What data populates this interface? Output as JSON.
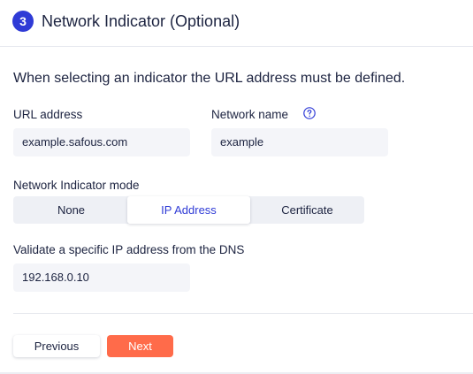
{
  "header": {
    "step_number": "3",
    "title": "Network Indicator (Optional)"
  },
  "intro_text": "When selecting an indicator the URL address must be defined.",
  "url_address": {
    "label": "URL address",
    "value": "example.safous.com"
  },
  "network_name": {
    "label": "Network name",
    "value": "example",
    "help_icon": "question-circle-icon"
  },
  "indicator_mode": {
    "label": "Network Indicator mode",
    "options": [
      "None",
      "IP Address",
      "Certificate"
    ],
    "selected": "IP Address"
  },
  "validate_ip": {
    "label": "Validate a specific IP address from the DNS",
    "value": "192.168.0.10"
  },
  "actions": {
    "previous_label": "Previous",
    "next_label": "Next"
  },
  "colors": {
    "accent": "#2f3bd6",
    "primary_button": "#ff6b4a",
    "field_background": "#f4f5f9",
    "text": "#1c2340"
  }
}
